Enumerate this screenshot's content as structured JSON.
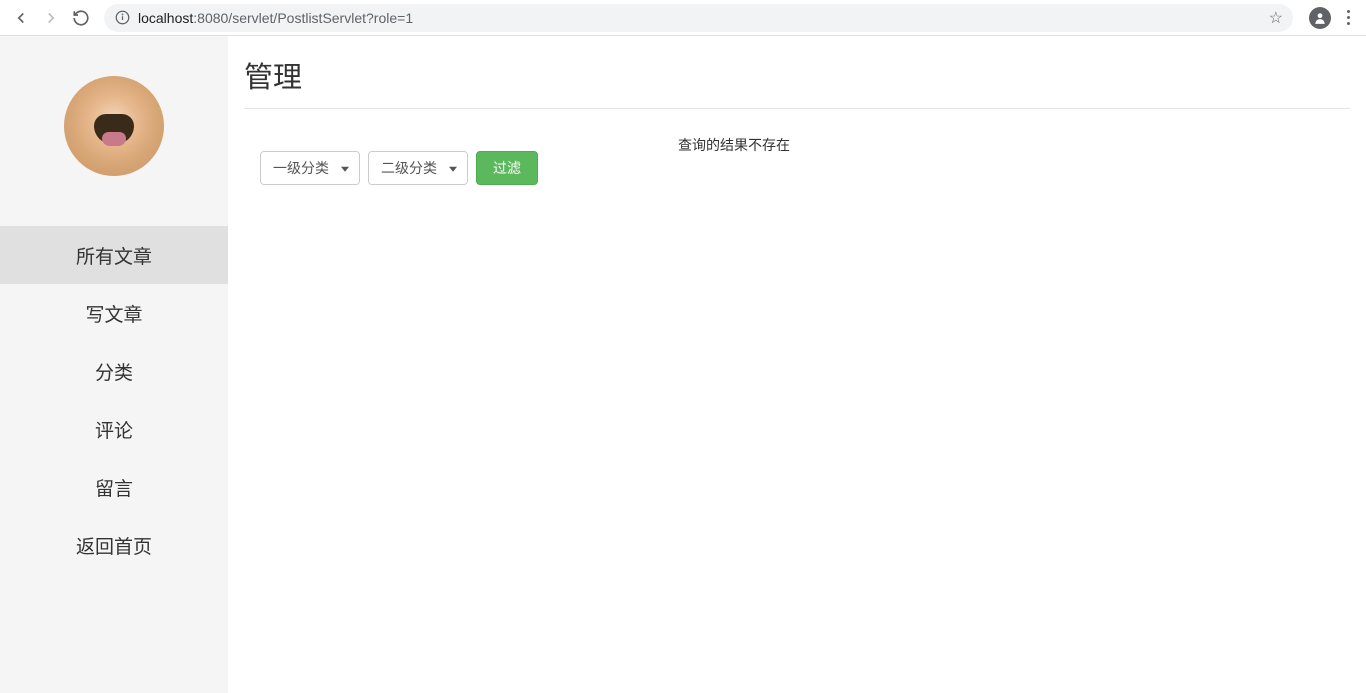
{
  "browser": {
    "url_host": "localhost",
    "url_path": ":8080/servlet/PostlistServlet?role=1"
  },
  "sidebar": {
    "items": [
      {
        "label": "所有文章",
        "active": true
      },
      {
        "label": "写文章",
        "active": false
      },
      {
        "label": "分类",
        "active": false
      },
      {
        "label": "评论",
        "active": false
      },
      {
        "label": "留言",
        "active": false
      },
      {
        "label": "返回首页",
        "active": false
      }
    ]
  },
  "main": {
    "title": "管理",
    "filter": {
      "select1": "一级分类",
      "select2": "二级分类",
      "button": "过滤"
    },
    "result_message": "查询的结果不存在"
  }
}
